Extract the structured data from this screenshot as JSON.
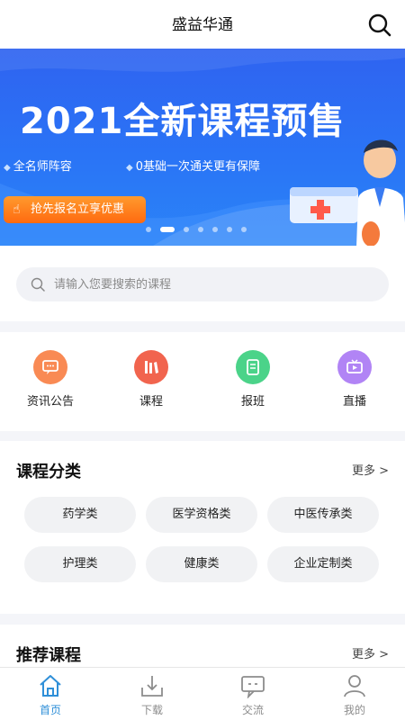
{
  "header": {
    "title": "盛益华通",
    "search_icon": "search-icon"
  },
  "banner": {
    "headline": "2021全新课程预售",
    "features": [
      "全名师阵容",
      "0基础一次通关更有保障"
    ],
    "cta": "抢先报名立享优惠",
    "slide_count": 7,
    "active_slide": 1,
    "colors": {
      "background": "#2b6ff3",
      "cta": "#ff7a1a"
    }
  },
  "search": {
    "placeholder": "请输入您要搜索的课程",
    "value": ""
  },
  "quick_nav": [
    {
      "label": "资讯公告",
      "icon": "message-icon",
      "color": "#f98a54"
    },
    {
      "label": "课程",
      "icon": "books-icon",
      "color": "#f1644e"
    },
    {
      "label": "报班",
      "icon": "book-icon",
      "color": "#4bd389"
    },
    {
      "label": "直播",
      "icon": "tv-icon",
      "color": "#b184f5"
    }
  ],
  "categories": {
    "title": "课程分类",
    "more": "更多 >",
    "items": [
      "药学类",
      "医学资格类",
      "中医传承类",
      "护理类",
      "健康类",
      "企业定制类"
    ]
  },
  "recommended": {
    "title": "推荐课程",
    "more": "更多 >"
  },
  "tabbar": {
    "items": [
      {
        "label": "首页",
        "icon": "home-icon",
        "active": true
      },
      {
        "label": "下载",
        "icon": "download-icon",
        "active": false
      },
      {
        "label": "交流",
        "icon": "chat-icon",
        "active": false
      },
      {
        "label": "我的",
        "icon": "user-icon",
        "active": false
      }
    ],
    "active_color": "#2f8fd8"
  }
}
